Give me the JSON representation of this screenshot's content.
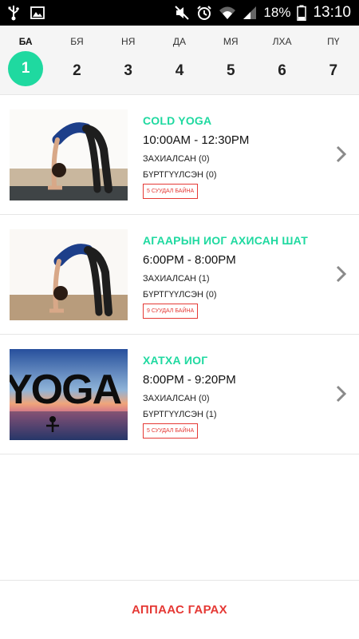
{
  "status_bar": {
    "battery": "18%",
    "time": "13:10"
  },
  "days": [
    {
      "label": "БА",
      "num": "1",
      "active": true
    },
    {
      "label": "БЯ",
      "num": "2"
    },
    {
      "label": "НЯ",
      "num": "3"
    },
    {
      "label": "ДА",
      "num": "4"
    },
    {
      "label": "МЯ",
      "num": "5"
    },
    {
      "label": "ЛХА",
      "num": "6"
    },
    {
      "label": "ПҮ",
      "num": "7"
    }
  ],
  "classes": [
    {
      "title": "COLD YOGA",
      "time": "10:00AM - 12:30PM",
      "booked": "ЗАХИАЛСАН (0)",
      "registered": "БҮРТГҮҮЛСЭН (0)",
      "seats": "5 СУУДАЛ БАЙНА"
    },
    {
      "title": "АГААРЫН ИОГ АХИСАН ШАТ",
      "time": "6:00PM - 8:00PM",
      "booked": "ЗАХИАЛСАН (1)",
      "registered": "БҮРТГҮҮЛСЭН (0)",
      "seats": "9 СУУДАЛ БАЙНА"
    },
    {
      "title": "ХАТХА ИОГ",
      "time": "8:00PM - 9:20PM",
      "booked": "ЗАХИАЛСАН (0)",
      "registered": "БҮРТГҮҮЛСЭН (1)",
      "seats": "5 СУУДАЛ БАЙНА"
    }
  ],
  "thumb_yoga_text": "YOGA",
  "footer": {
    "logout": "АППААС ГАРАХ"
  },
  "colors": {
    "accent": "#1fd9a0",
    "alert": "#e53935"
  }
}
